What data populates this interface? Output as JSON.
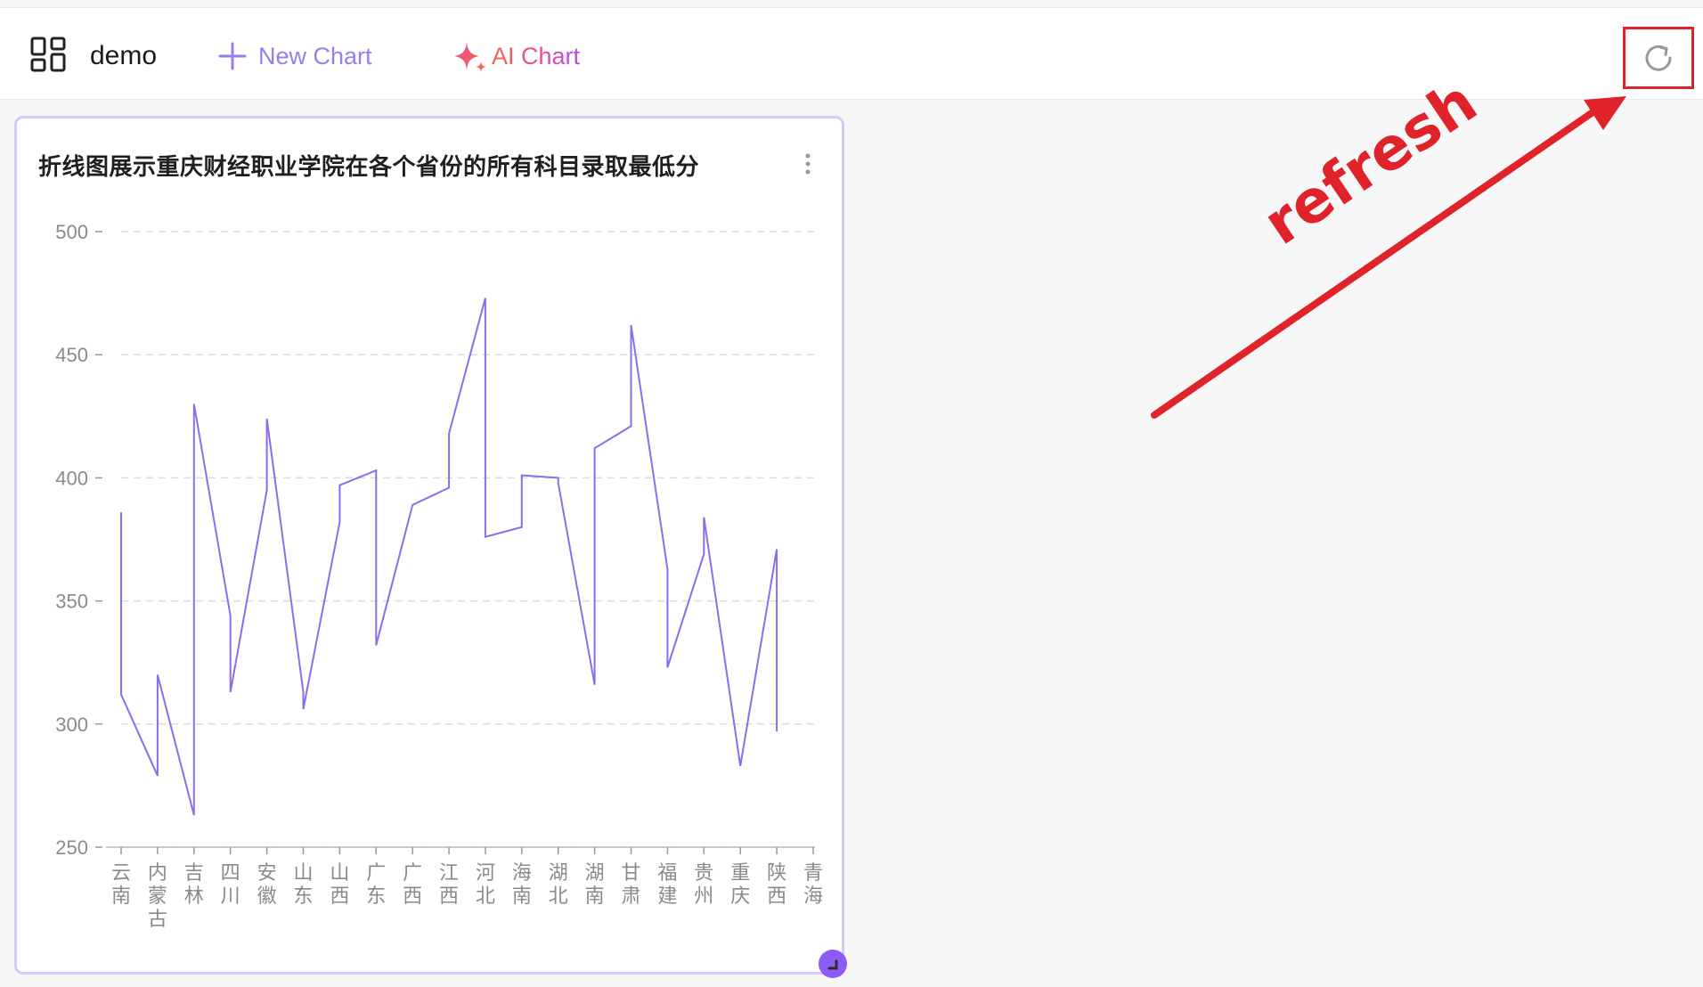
{
  "header": {
    "app_title": "demo",
    "new_chart_label": "New Chart",
    "ai_chart_label": "AI Chart",
    "icons": {
      "app": "dashboard-grid-icon",
      "new_chart": "plus-icon",
      "ai_chart": "sparkle-icon",
      "refresh": "refresh-icon"
    }
  },
  "card": {
    "title": "折线图展示重庆财经职业学院在各个省份的所有科目录取最低分",
    "menu_icon": "more-vertical-icon",
    "resize_icon": "resize-handle-icon"
  },
  "annotation": {
    "text": "refresh",
    "color": "#e0222a"
  },
  "colors": {
    "accent": "#9b7cf0",
    "line": "#8b6cf0",
    "card_border": "#d6c8fb",
    "annotation": "#e0222a"
  },
  "chart_data": {
    "type": "line",
    "title": "",
    "xlabel": "",
    "ylabel": "",
    "ylim": [
      250,
      500
    ],
    "yticks": [
      500,
      450,
      400,
      350,
      300,
      250
    ],
    "grid": true,
    "categories": [
      "云南",
      "内蒙古",
      "吉林",
      "四川",
      "安徽",
      "山东",
      "山西",
      "广东",
      "广西",
      "江西",
      "河北",
      "海南",
      "湖北",
      "湖南",
      "甘肃",
      "福建",
      "贵州",
      "重庆",
      "陕西",
      "青海"
    ],
    "series": [
      {
        "values": [
          [
            386,
            312
          ],
          [
            279,
            320
          ],
          [
            263,
            430
          ],
          [
            344,
            313
          ],
          [
            395,
            424
          ],
          [
            313,
            306
          ],
          [
            382,
            397
          ],
          [
            403,
            332
          ],
          [
            389
          ],
          [
            396,
            418
          ],
          [
            473,
            376
          ],
          [
            380,
            401
          ],
          [
            400,
            398
          ],
          [
            316,
            412
          ],
          [
            421,
            462
          ],
          [
            363,
            323
          ],
          [
            369,
            384
          ],
          [
            283
          ],
          [
            371,
            297
          ],
          []
        ]
      }
    ]
  }
}
